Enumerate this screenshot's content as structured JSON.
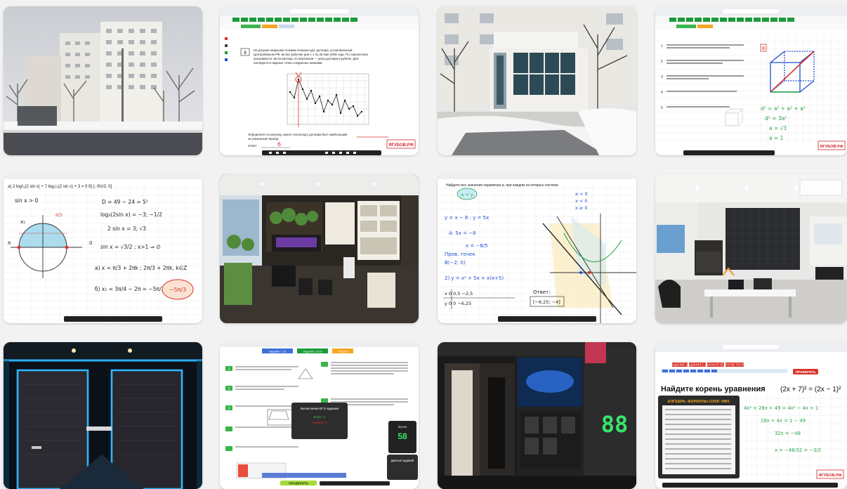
{
  "colors": {
    "page_bg": "#f2f2f2",
    "brand_green": "#1a9b3c",
    "brand_red": "#d3262b",
    "neon_blue": "#2fb6ff",
    "neon_green": "#38e36b",
    "pen_blue": "#1f4fd1",
    "pen_red": "#d9332b",
    "pen_green": "#2aa34a"
  },
  "tiles": {
    "t2": {
      "task_num": "8",
      "task_text_1": "На рисунке жирными точками показан курс доллара, установленный",
      "task_text_2": "Центробанком РФ, во все рабочие дни с 1 по 28 мая 2009 года. По горизонтали",
      "task_text_3": "указываются числа месяца, по вертикали — цена доллара в рублях. Для",
      "task_text_4": "наглядности жирные точки соединены линиями.",
      "question_1": "Определите по рисунку, какого числа курс доллара был наибольшим",
      "question_2": "за указанный период.",
      "answer_label": "Ответ:",
      "answer_value": "6",
      "brand": "ЯГУБОВ.РФ"
    },
    "t4": {
      "num_1": "1",
      "num_2": "2",
      "num_3": "3",
      "num_4": "4",
      "num_5": "5",
      "answer_red": "8",
      "f1": "d² = a² + a² + a²",
      "f2": "d² = 3a²",
      "f3": "a = √3",
      "f4": "a = 1",
      "brand": "ЯГУБОВ.РФ"
    },
    "t5": {
      "header": "a) 2 log²₉(2 sin x) + 7 log₁/₃(2 sin x) + 3 = 0    б) [−5π/2; 0]",
      "l1": "sin x > 0",
      "l2": "D = 49 − 24 = 5²",
      "l3": "log₃(2sin x) = −3; −1/2",
      "l4": "2 sin x = 3; √3",
      "l5": "sin x = √3/2 ; x>1 ⇒ ∅",
      "l6": "a) x = π/3 + 2πk ; 2π/3 + 2πk, k∈Z",
      "l7": "б) x₁ = 3π/4 − 2π = −5π/3",
      "ans": "−5π/3",
      "x_label": "x₁",
      "zero_label": "0",
      "pi_label": "π",
      "pi3_label": "π/3"
    },
    "t7": {
      "header": "Найдите все значения параметра a, при каждом из которых система",
      "l1": "y = x − 8 ;  y = 5x",
      "l2": "A: 5x = −8",
      "l3": "x = −8/5",
      "l4": "Пров. точек",
      "l5": "B(−2; 0)",
      "l6": "2) y = x² + 5x + x(x+5)",
      "l7": "x  0  0,5  −2,5",
      "l8": "y  0  0   −6,25",
      "l9": "Ответ:",
      "l10": "[−6,25; −4]",
      "ans_tag": "a = y",
      "c1": "a < 0",
      "c2": "x < 0",
      "c3": "x ≥ 0"
    },
    "t10": {
      "tab_1": "Задание 1-12",
      "tab_2": "Задание 13-19",
      "tab_3": "Теория",
      "popup_title": "Вычисления ЕГЭ задание",
      "popup_l1": "Верно: 0",
      "popup_l2": "Неверно: 0",
      "timer_label": "Время",
      "timer_value": "58",
      "btn_check": "ПРОВЕРИТЬ",
      "card_title": "Данные заданий",
      "task_a": "1",
      "task_b": "2",
      "task_c": "3"
    },
    "t12": {
      "tabs": [
        "ЗАДАНИЕ 13",
        "ЗАДАНИЯ 1-12",
        "ВАРИАНТ ЕГЭ",
        "ДРУГИЕ ТЕСТЫ"
      ],
      "btn": "ПРОВЕРИТЬ",
      "title": "Найдите корень уравнения",
      "equation": "(2x + 7)² = (2x − 1)²",
      "panel_title": "АЛГЕБРА: ФОРМУЛЫ СОКР. УМН.",
      "s1": "4x² + 28x + 49 = 4x² − 4x + 1",
      "s2": "28x + 4x = 1 − 49",
      "s3": "32x = −48",
      "s4": "x = −48/32 = −3/2",
      "brand": "ЯГУБОВ.РФ"
    },
    "t11": {
      "clock": "88"
    }
  }
}
